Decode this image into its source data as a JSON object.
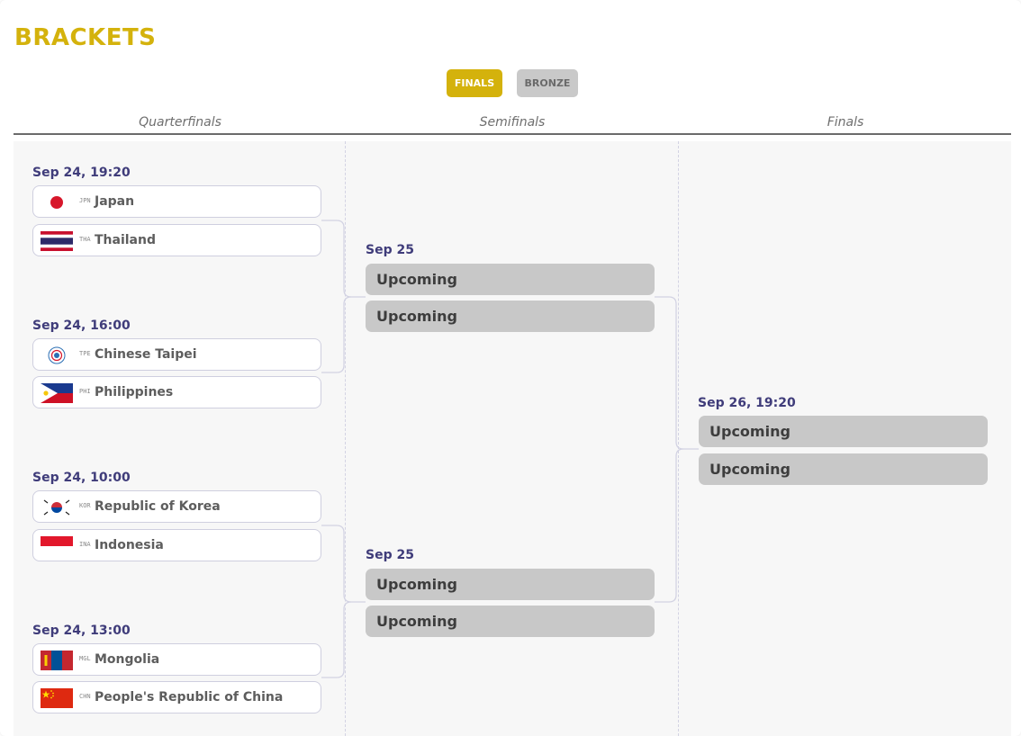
{
  "page": {
    "title": "BRACKETS",
    "tabs": [
      {
        "label": "FINALS",
        "active": true
      },
      {
        "label": "BRONZE",
        "active": false
      }
    ],
    "rounds": [
      "Quarterfinals",
      "Semifinals",
      "Finals"
    ]
  },
  "colors": {
    "accent": "#d4b20c",
    "date_text": "#3f3c7a",
    "upcoming_bg": "#c8c8c8",
    "connector": "#d3d3e3"
  },
  "quarterfinals": [
    {
      "date": "Sep 24, 19:20",
      "teams": [
        {
          "code": "JPN",
          "name": "Japan",
          "flag": "japan-flag-icon"
        },
        {
          "code": "THA",
          "name": "Thailand",
          "flag": "thailand-flag-icon"
        }
      ]
    },
    {
      "date": "Sep 24, 16:00",
      "teams": [
        {
          "code": "TPE",
          "name": "Chinese Taipei",
          "flag": "chinese-taipei-flag-icon"
        },
        {
          "code": "PHI",
          "name": "Philippines",
          "flag": "philippines-flag-icon"
        }
      ]
    },
    {
      "date": "Sep 24, 10:00",
      "teams": [
        {
          "code": "KOR",
          "name": "Republic of Korea",
          "flag": "korea-flag-icon"
        },
        {
          "code": "INA",
          "name": "Indonesia",
          "flag": "indonesia-flag-icon"
        }
      ]
    },
    {
      "date": "Sep 24, 13:00",
      "teams": [
        {
          "code": "MGL",
          "name": "Mongolia",
          "flag": "mongolia-flag-icon"
        },
        {
          "code": "CHN",
          "name": "People's Republic of China",
          "flag": "china-flag-icon"
        }
      ]
    }
  ],
  "semifinals": [
    {
      "date": "Sep 25",
      "slots": [
        "Upcoming",
        "Upcoming"
      ]
    },
    {
      "date": "Sep 25",
      "slots": [
        "Upcoming",
        "Upcoming"
      ]
    }
  ],
  "finals": [
    {
      "date": "Sep 26, 19:20",
      "slots": [
        "Upcoming",
        "Upcoming"
      ]
    }
  ]
}
